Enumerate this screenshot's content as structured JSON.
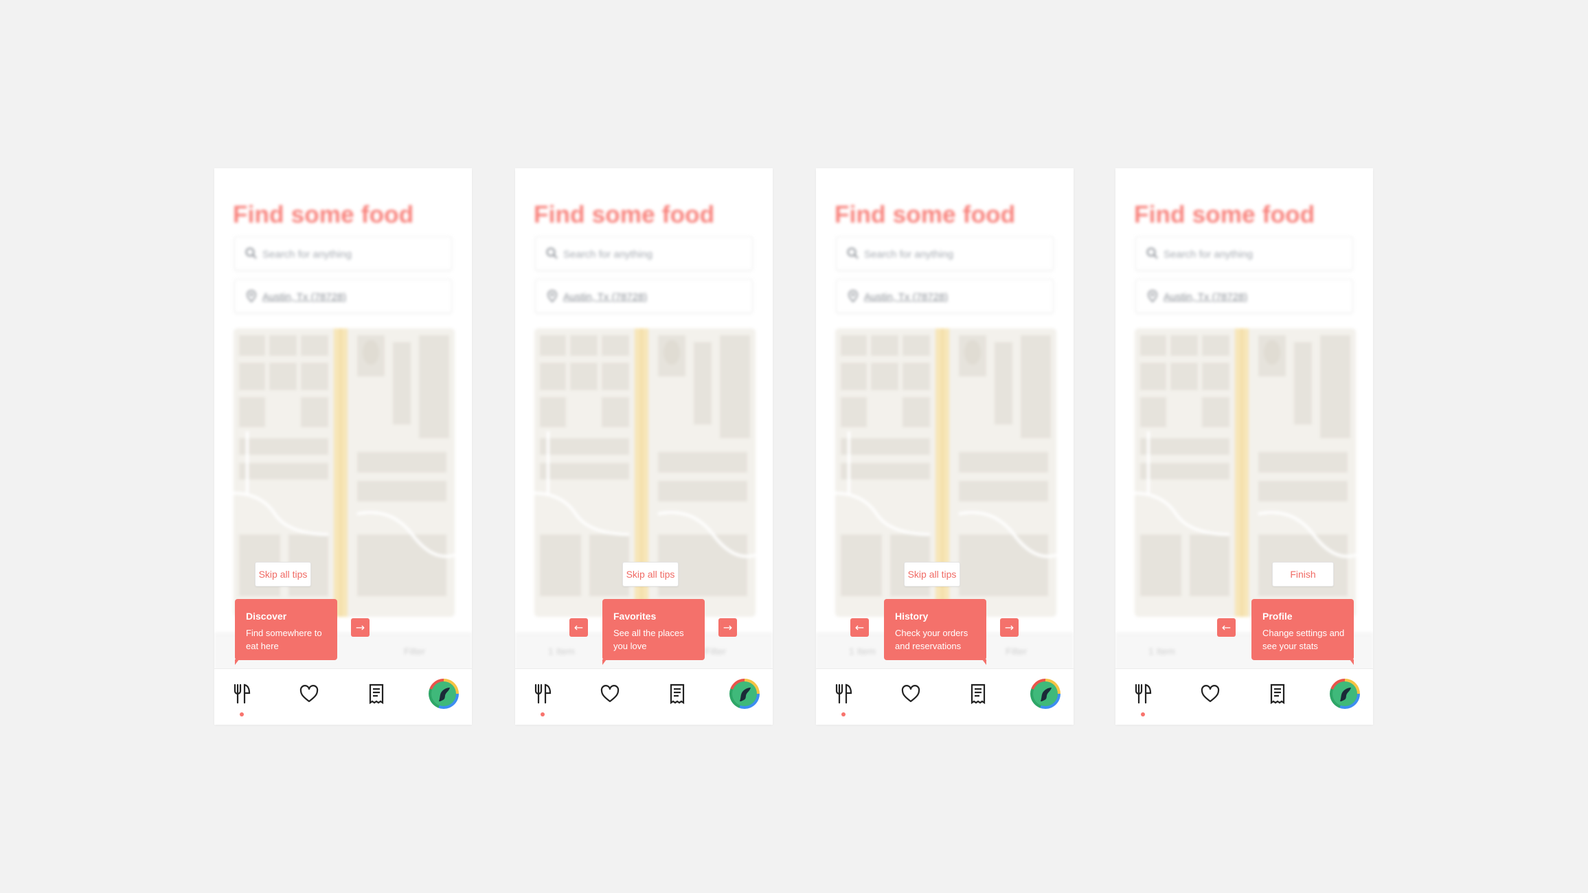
{
  "screen": {
    "title": "Find some food",
    "search_placeholder": "Search for anything",
    "location": "Austin, Tx (78728)",
    "filter_left": "1 Item",
    "filter_right": "Filter",
    "tabs": [
      "fork-knife-icon",
      "heart-icon",
      "receipt-icon",
      "avatar"
    ]
  },
  "colors": {
    "accent": "#f4716b",
    "title": "#f8827c",
    "background": "#f2f2f2"
  },
  "phones": [
    {
      "button": "Skip all tips",
      "tip_title": "Discover",
      "tip_body": "Find somewhere to eat here",
      "prev": "",
      "next": "→"
    },
    {
      "button": "Skip all tips",
      "tip_title": "Favorites",
      "tip_body": "See all the places you love",
      "prev": "←",
      "next": "→"
    },
    {
      "button": "Skip all tips",
      "tip_title": "History",
      "tip_body": "Check your orders and reservations",
      "prev": "←",
      "next": "→"
    },
    {
      "button": "Finish",
      "tip_title": "Profile",
      "tip_body": "Change settings and see your stats",
      "prev": "←",
      "next": ""
    }
  ]
}
